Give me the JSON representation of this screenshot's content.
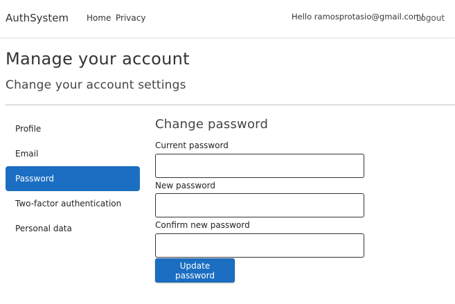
{
  "navbar": {
    "brand": "AuthSystem",
    "links": [
      "Home",
      "Privacy"
    ],
    "greeting": "Hello ramosprotasio@gmail.com!",
    "logout": "Logout"
  },
  "page": {
    "title": "Manage your account",
    "subtitle": "Change your account settings"
  },
  "sidebar": {
    "items": [
      {
        "label": "Profile",
        "active": false
      },
      {
        "label": "Email",
        "active": false
      },
      {
        "label": "Password",
        "active": true
      },
      {
        "label": "Two-factor authentication",
        "active": false
      },
      {
        "label": "Personal data",
        "active": false
      }
    ]
  },
  "form": {
    "title": "Change password",
    "fields": [
      {
        "label": "Current password",
        "value": ""
      },
      {
        "label": "New password",
        "value": ""
      },
      {
        "label": "Confirm new password",
        "value": ""
      }
    ],
    "submit_label": "Update password"
  },
  "colors": {
    "accent": "#1b6ec2",
    "divider": "#bfbfbf",
    "text": "#222222"
  }
}
